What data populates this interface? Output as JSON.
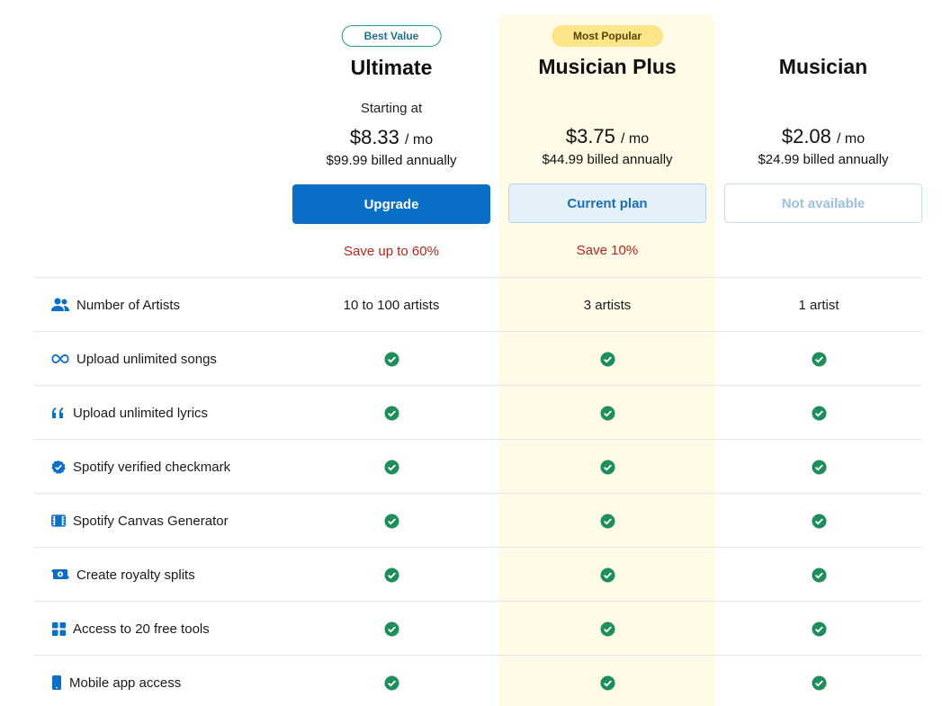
{
  "plans": [
    {
      "id": "ultimate",
      "badge": "Best Value",
      "name": "Ultimate",
      "starting": "Starting at",
      "price": "$8.33",
      "per": "/ mo",
      "billed": "$99.99 billed annually",
      "button": "Upgrade",
      "save": "Save up to 60%"
    },
    {
      "id": "musician-plus",
      "badge": "Most Popular",
      "name": "Musician Plus",
      "price": "$3.75",
      "per": "/ mo",
      "billed": "$44.99 billed annually",
      "button": "Current plan",
      "save": "Save 10%"
    },
    {
      "id": "musician",
      "name": "Musician",
      "price": "$2.08",
      "per": "/ mo",
      "billed": "$24.99 billed annually",
      "button": "Not available"
    }
  ],
  "features": [
    {
      "label": "Number of Artists",
      "icon": "users-icon",
      "values": [
        "10 to 100 artists",
        "3 artists",
        "1 artist"
      ]
    },
    {
      "label": "Upload unlimited songs",
      "icon": "infinity-icon"
    },
    {
      "label": "Upload unlimited lyrics",
      "icon": "quote-icon"
    },
    {
      "label": "Spotify verified checkmark",
      "icon": "verified-badge-icon"
    },
    {
      "label": "Spotify Canvas Generator",
      "icon": "film-icon"
    },
    {
      "label": "Create royalty splits",
      "icon": "money-exchange-icon"
    },
    {
      "label": "Access to 20 free tools",
      "icon": "grid-icon"
    },
    {
      "label": "Mobile app access",
      "icon": "mobile-phone-icon"
    }
  ],
  "colors": {
    "primary": "#0a6fc6",
    "highlight": "#fffbe6",
    "save": "#b3261e",
    "check": "#1e8e5a",
    "badge_popular": "#fde58a"
  }
}
